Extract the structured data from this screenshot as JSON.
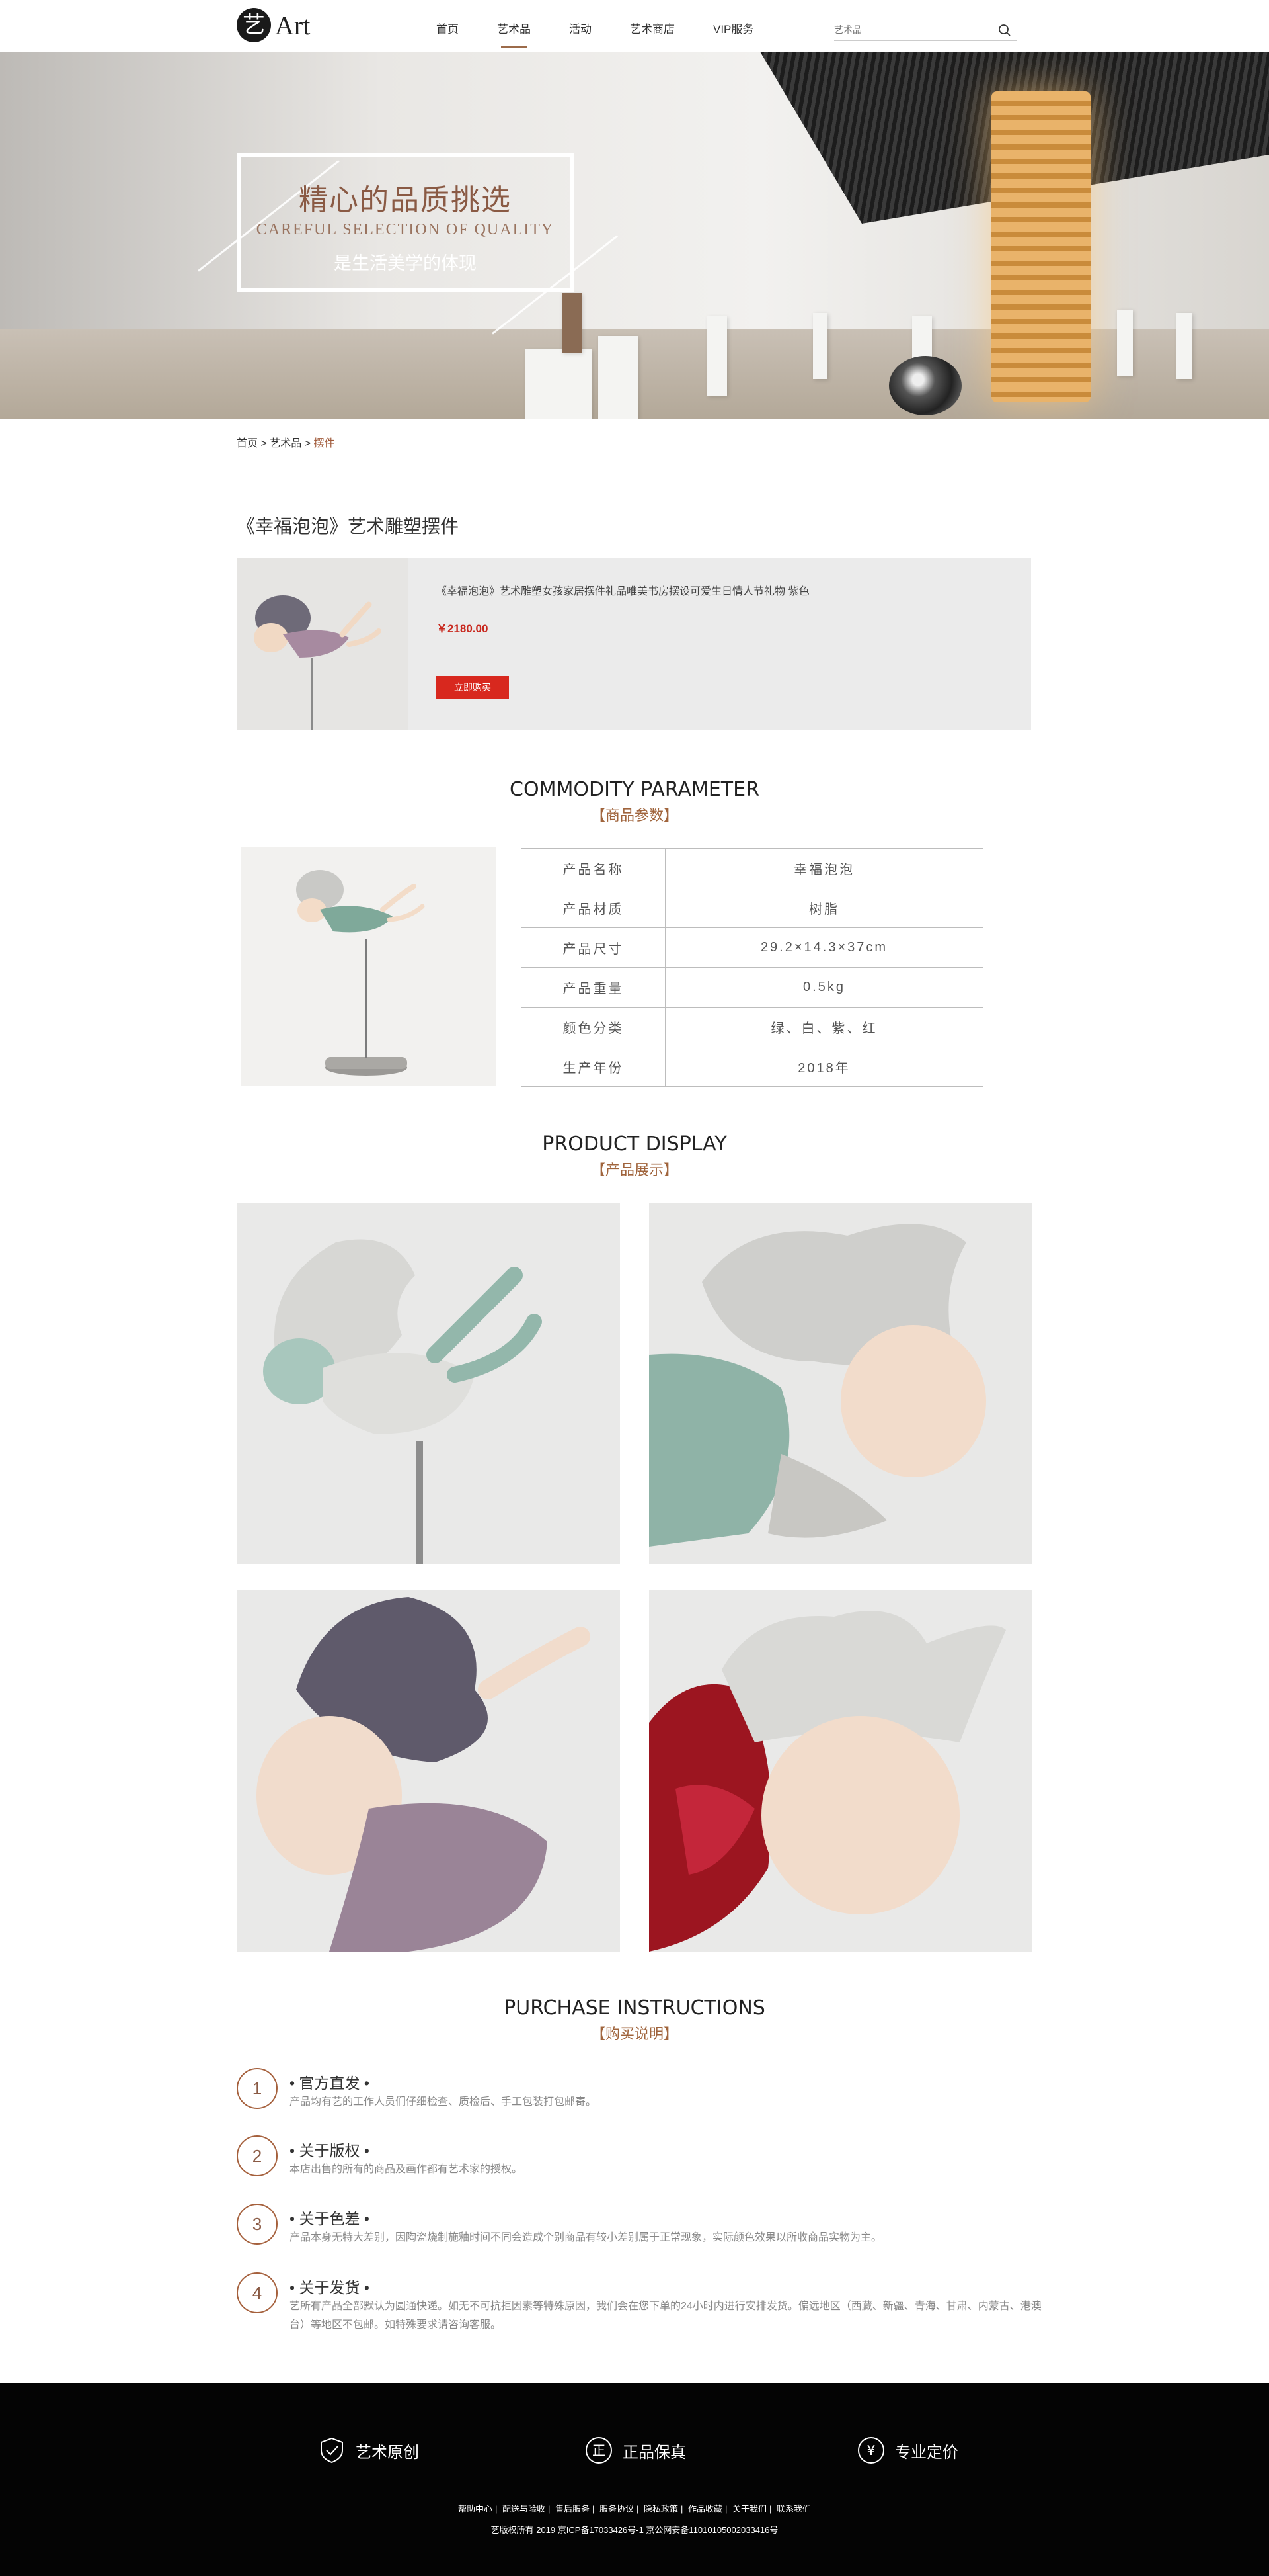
{
  "header": {
    "logo_char": "艺",
    "logo_text": "Art",
    "nav": [
      "首页",
      "艺术品",
      "活动",
      "艺术商店",
      "VIP服务"
    ],
    "search_placeholder": "艺术品"
  },
  "banner": {
    "title": "精心的品质挑选",
    "subtitle": "CAREFUL SELECTION OF QUALITY",
    "slogan": "是生活美学的体现"
  },
  "breadcrumb": {
    "home": "首页",
    "sep1": " > ",
    "category": "艺术品",
    "sep2": " > ",
    "current": "摆件"
  },
  "product": {
    "title": "《幸福泡泡》艺术雕塑摆件",
    "name": "《幸福泡泡》艺术雕塑女孩家居摆件礼品唯美书房摆设可爱生日情人节礼物 紫色",
    "price": "￥2180.00",
    "buy_label": "立即购买"
  },
  "params_section": {
    "en": "COMMODITY PARAMETER",
    "cn": "【商品参数】",
    "rows": [
      {
        "k": "产品名称",
        "v": "幸福泡泡"
      },
      {
        "k": "产品材质",
        "v": "树脂"
      },
      {
        "k": "产品尺寸",
        "v": "29.2×14.3×37cm"
      },
      {
        "k": "产品重量",
        "v": "0.5kg"
      },
      {
        "k": "颜色分类",
        "v": "绿、白、紫、红"
      },
      {
        "k": "生产年份",
        "v": "2018年"
      }
    ]
  },
  "display_section": {
    "en": "PRODUCT DISPLAY",
    "cn": "【产品展示】"
  },
  "instructions_section": {
    "en": "PURCHASE INSTRUCTIONS",
    "cn": "【购买说明】",
    "items": [
      {
        "num": "1",
        "title": "• 官方直发 •",
        "text": "产品均有艺的工作人员们仔细检查、质检后、手工包装打包邮寄。"
      },
      {
        "num": "2",
        "title": "• 关于版权 •",
        "text": "本店出售的所有的商品及画作都有艺术家的授权。"
      },
      {
        "num": "3",
        "title": "• 关于色差 •",
        "text": "产品本身无特大差别，因陶瓷烧制施釉时间不同会造成个别商品有较小差别属于正常现象，实际颜色效果以所收商品实物为主。"
      },
      {
        "num": "4",
        "title": "• 关于发货 •",
        "text": "艺所有产品全部默认为圆通快递。如无不可抗拒因素等特殊原因，我们会在您下单的24小时内进行安排发货。偏远地区（西藏、新疆、青海、甘肃、内蒙古、港澳台）等地区不包邮。如特殊要求请咨询客服。"
      }
    ]
  },
  "footer": {
    "features": [
      {
        "icon": "shield-icon",
        "label": "艺术原创"
      },
      {
        "icon": "authentic-icon",
        "label": "正品保真",
        "glyph": "正"
      },
      {
        "icon": "yen-icon",
        "label": "专业定价",
        "glyph": "¥"
      }
    ],
    "links": [
      "帮助中心",
      "配送与验收",
      "售后服务",
      "服务协议",
      "隐私政策",
      "作品收藏",
      "关于我们",
      "联系我们"
    ],
    "copyright": "艺版权所有    2019 京ICP备17033426号-1 京公网安备11010105002033416号"
  },
  "colors": {
    "accent": "#9c6b4a",
    "price": "#c8281e",
    "buy_button": "#d8281e",
    "footer_bg": "#040404"
  }
}
